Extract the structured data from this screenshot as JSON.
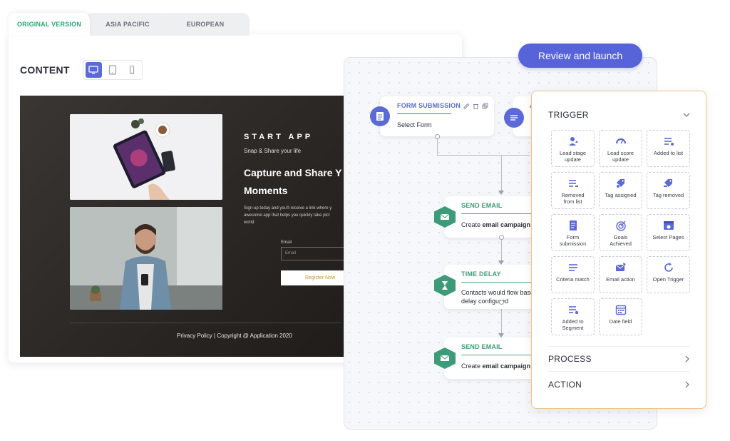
{
  "editor": {
    "tabs": [
      {
        "label": "ORIGINAL VERSION",
        "active": true
      },
      {
        "label": "ASIA PACIFIC",
        "active": false
      },
      {
        "label": "EUROPEAN",
        "active": false
      }
    ],
    "content_title": "CONTENT",
    "devices": [
      "desktop-icon",
      "tablet-icon",
      "mobile-icon"
    ],
    "active_device": "desktop",
    "preview": {
      "app_title": "START APP",
      "tagline": "Snap & Share your life",
      "headline_1": "Capture and Share Y",
      "headline_2": "Moments",
      "body_1": "Sign-up today and you'll receive a link where y",
      "body_2": "awesome app that helps you quickly take pict",
      "body_3": "world",
      "email_label": "Email",
      "email_placeholder": "Email",
      "register_label": "Register Now",
      "footer": "Privacy Policy  |  Copyright @ Application 2020"
    }
  },
  "flow": {
    "review_label": "Review and launch",
    "nodes": [
      {
        "title": "FORM SUBMISSION",
        "subtitle": "Select Form"
      },
      {
        "title": "A",
        "subtitle": ""
      },
      {
        "title": "SEND EMAIL",
        "subtitle_pre": "Create ",
        "subtitle_bold": "email campaign"
      },
      {
        "title": "TIME DELAY",
        "subtitle_1": "Contacts would flow based",
        "subtitle_2": "delay configured"
      },
      {
        "title": "SEND EMAIL",
        "subtitle_pre": "Create ",
        "subtitle_bold": "email campaign"
      }
    ]
  },
  "trigger_panel": {
    "trigger_title": "TRIGGER",
    "tiles": [
      {
        "label_1": "Lead stage",
        "label_2": "update",
        "icon": "lead-stage-icon"
      },
      {
        "label_1": "Lead score",
        "label_2": "update",
        "icon": "gauge-icon"
      },
      {
        "label_1": "Added to list",
        "label_2": "",
        "icon": "list-add-icon"
      },
      {
        "label_1": "Removed",
        "label_2": "from list",
        "icon": "list-remove-icon"
      },
      {
        "label_1": "Tag assigned",
        "label_2": "",
        "icon": "tag-add-icon"
      },
      {
        "label_1": "Tag removed",
        "label_2": "",
        "icon": "tag-remove-icon"
      },
      {
        "label_1": "Form",
        "label_2": "submission",
        "icon": "form-icon"
      },
      {
        "label_1": "Goals",
        "label_2": "Achieved",
        "icon": "target-icon"
      },
      {
        "label_1": "Select Pages",
        "label_2": "",
        "icon": "page-icon"
      },
      {
        "label_1": "Criteria match",
        "label_2": "",
        "icon": "criteria-icon"
      },
      {
        "label_1": "Email action",
        "label_2": "",
        "icon": "email-action-icon"
      },
      {
        "label_1": "Open Trigger",
        "label_2": "",
        "icon": "refresh-icon"
      },
      {
        "label_1": "Added to",
        "label_2": "Segment",
        "icon": "segment-icon"
      },
      {
        "label_1": "Date field",
        "label_2": "",
        "icon": "calendar-icon"
      }
    ],
    "process_title": "PROCESS",
    "action_title": "ACTION"
  },
  "colors": {
    "accent": "#5b6ad6",
    "review_button": "#5763d8",
    "green": "#3e9b7a",
    "active_tab_text": "#2aa878",
    "trigger_border": "#f2c189"
  }
}
